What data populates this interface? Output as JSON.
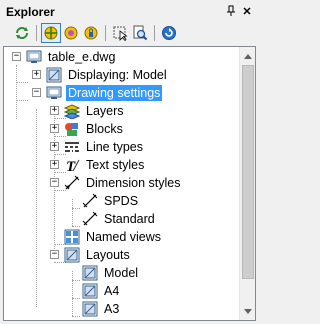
{
  "window": {
    "title": "Explorer"
  },
  "toolbar": {
    "buttons": [
      {
        "icon": "refresh-icon"
      },
      {
        "icon": "layer-on-icon",
        "selected": true
      },
      {
        "icon": "layer-freeze-icon"
      },
      {
        "icon": "layer-lock-icon"
      },
      {
        "icon": "select-objects-icon"
      },
      {
        "icon": "zoom-objects-icon"
      },
      {
        "icon": "help-icon"
      }
    ]
  },
  "tree": {
    "root": "table_e.dwg",
    "displaying": "Displaying: Model",
    "drawing_settings": "Drawing settings",
    "layers": "Layers",
    "blocks": "Blocks",
    "line_types": "Line types",
    "text_styles": "Text styles",
    "dimension_styles": "Dimension styles",
    "spds": "SPDS",
    "standard": "Standard",
    "named_views": "Named views",
    "layouts": "Layouts",
    "model": "Model",
    "a4": "A4",
    "a3": "A3"
  },
  "colors": {
    "selection": "#3399ff",
    "accent": "#3c7fb1"
  }
}
